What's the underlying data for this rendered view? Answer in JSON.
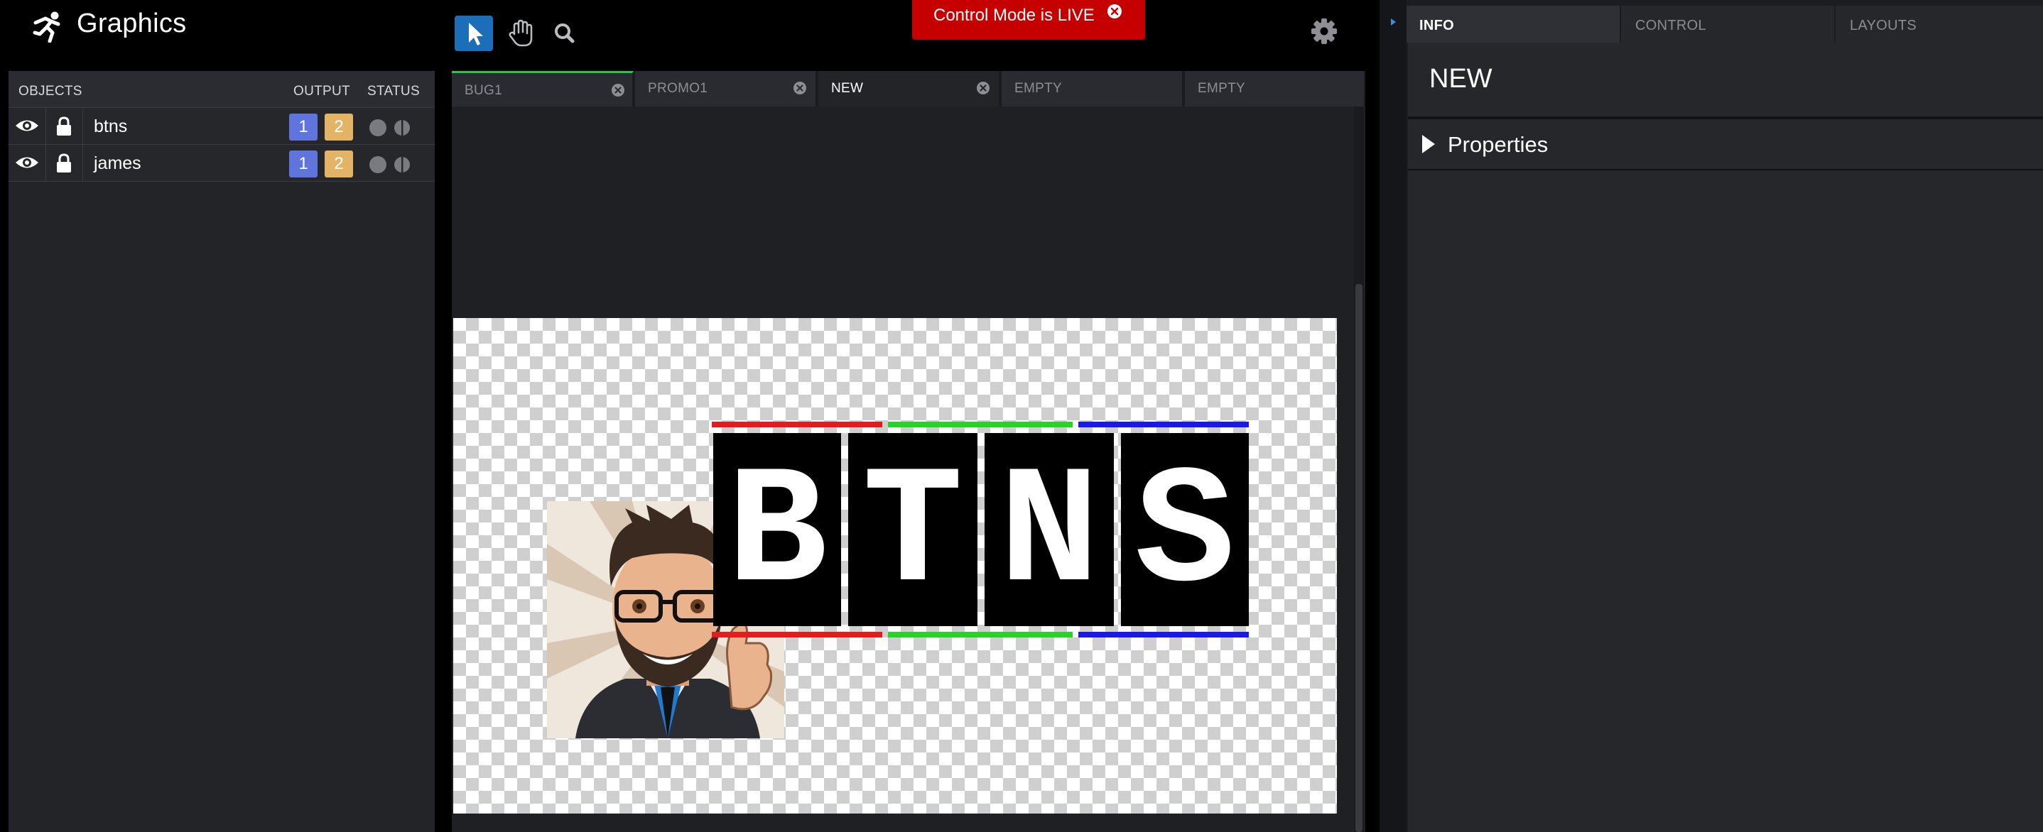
{
  "app": {
    "title": "Graphics"
  },
  "toolbar": {
    "tools": [
      "select-tool",
      "pan-tool",
      "zoom-tool"
    ],
    "settings_icon": "gear-icon"
  },
  "banner": {
    "text": "Control Mode is LIVE",
    "color": "#c60000"
  },
  "objects_panel": {
    "headers": {
      "objects": "OBJECTS",
      "output": "OUTPUT",
      "status": "STATUS"
    },
    "rows": [
      {
        "name": "btns",
        "outputs": [
          "1",
          "2"
        ]
      },
      {
        "name": "james",
        "outputs": [
          "1",
          "2"
        ]
      }
    ]
  },
  "layout_tabs": [
    {
      "label": "BUG1",
      "active": false,
      "closable": true,
      "indicator": "#2ec44b"
    },
    {
      "label": "PROMO1",
      "active": false,
      "closable": true
    },
    {
      "label": "NEW",
      "active": true,
      "closable": true
    },
    {
      "label": "EMPTY",
      "active": false,
      "closable": false
    },
    {
      "label": "EMPTY",
      "active": false,
      "closable": false
    }
  ],
  "canvas": {
    "logo_letters": [
      "B",
      "T",
      "N",
      "S"
    ],
    "stripe_colors": [
      "#e11d1d",
      "#29d129",
      "#1a1ae6"
    ]
  },
  "right_panel": {
    "tabs": [
      {
        "label": "INFO",
        "active": true
      },
      {
        "label": "CONTROL",
        "active": false
      },
      {
        "label": "LAYOUTS",
        "active": false
      }
    ],
    "title": "NEW",
    "section": "Properties"
  },
  "colors": {
    "accent": "#1b6fb8",
    "output_1": "#5f74dc",
    "output_2": "#e3b465"
  }
}
